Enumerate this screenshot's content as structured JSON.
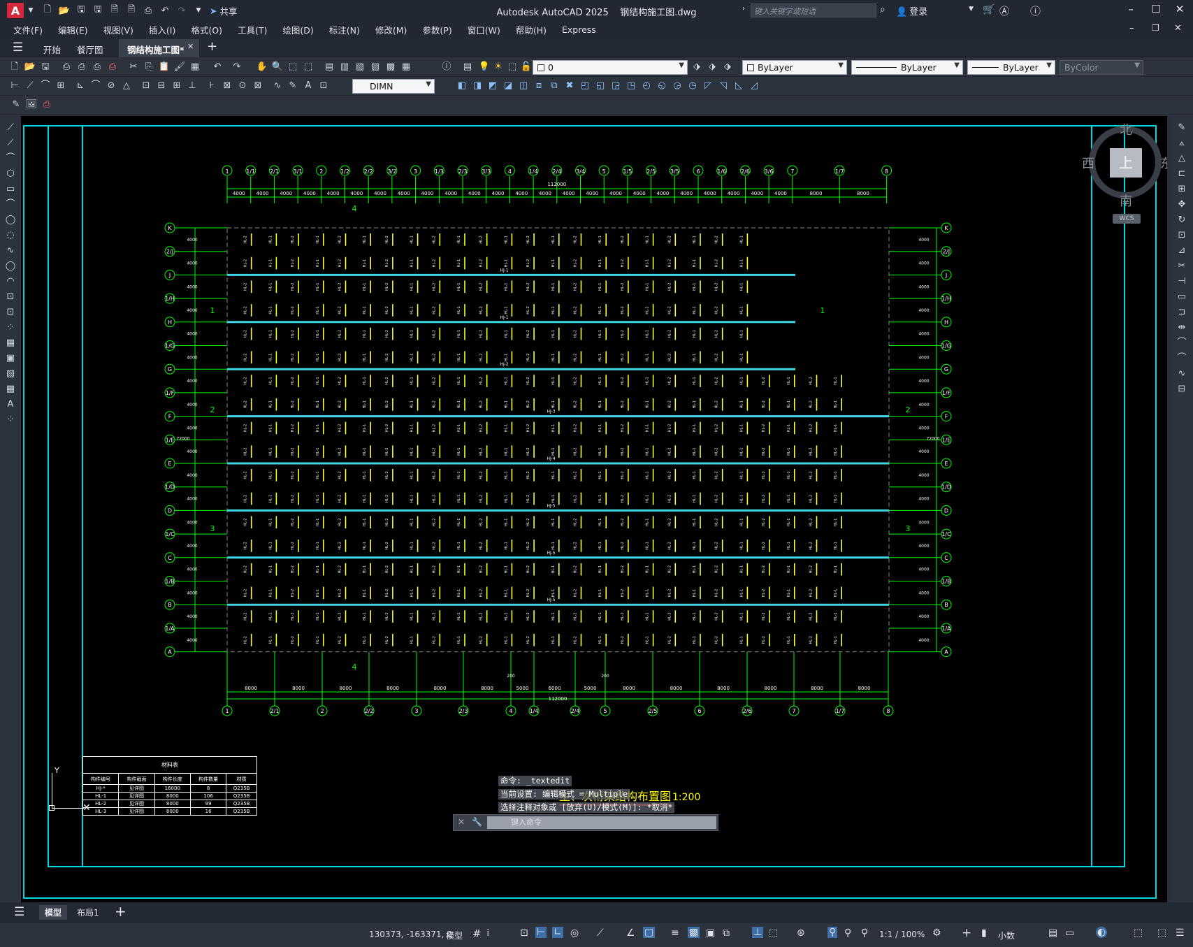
{
  "app": {
    "title": "Autodesk AutoCAD 2025",
    "file": "钢结构施工图.dwg",
    "share": "共享",
    "search_placeholder": "键入关键字或短语",
    "login": "登录",
    "logo": "A"
  },
  "menu": [
    "文件(F)",
    "编辑(E)",
    "视图(V)",
    "插入(I)",
    "格式(O)",
    "工具(T)",
    "绘图(D)",
    "标注(N)",
    "修改(M)",
    "参数(P)",
    "窗口(W)",
    "帮助(H)",
    "Express"
  ],
  "tabs": [
    "开始",
    "餐厅图",
    "钢结构施工图*"
  ],
  "toolbar": {
    "layer_value": "0",
    "color_value": "ByLayer",
    "linetype_value": "ByLayer",
    "lineweight_value": "ByLayer",
    "plotstyle_value": "ByColor",
    "dimstyle_value": "DIMN"
  },
  "viewcube": {
    "n": "北",
    "s": "南",
    "e": "东",
    "w": "西",
    "top": "上",
    "wcs": "WCS"
  },
  "drawing": {
    "title": "主、次桁架结构布置图",
    "scale": "1:200",
    "top_axes": [
      "1",
      "1/1",
      "2/1",
      "3/1",
      "2",
      "1/2",
      "2/2",
      "3/2",
      "3",
      "1/3",
      "2/3",
      "3/3",
      "4",
      "1/4",
      "2/4",
      "3/4",
      "5",
      "1/5",
      "2/5",
      "3/5",
      "6",
      "1/6",
      "2/6",
      "3/6",
      "7",
      "1/7",
      "8"
    ],
    "bottom_axes": [
      "1",
      "2/1",
      "2",
      "2/2",
      "3",
      "2/3",
      "4",
      "1/4",
      "2/4",
      "5",
      "2/5",
      "6",
      "2/6",
      "7",
      "1/7",
      "8"
    ],
    "row_axes": [
      "K",
      "2/J",
      "J",
      "1/H",
      "H",
      "1/G",
      "G",
      "1/F",
      "F",
      "1/E",
      "E",
      "1/D",
      "D",
      "1/C",
      "C",
      "1/B",
      "B",
      "1/A",
      "A"
    ],
    "top_dims": [
      "4000",
      "4000",
      "4000",
      "4000",
      "4000",
      "4000",
      "4000",
      "4000",
      "4000",
      "4000",
      "4000",
      "4000",
      "4000",
      "4000",
      "4000",
      "4000",
      "4000",
      "4000",
      "4000",
      "4000",
      "4000",
      "4000",
      "4000",
      "4000",
      "8000",
      "8000"
    ],
    "bottom_dims": [
      "8000",
      "8000",
      "8000",
      "8000",
      "8000",
      "8000",
      "5000",
      "6000",
      "5000",
      "8000",
      "8000",
      "8000",
      "8000",
      "8000",
      "8000"
    ],
    "total_dim": "112000",
    "side_total": "72000",
    "side_dim": "4000",
    "truss_labels": [
      "HJ-1",
      "HJ-1",
      "HJ-2",
      "HJ-3",
      "HJ-4",
      "HJ-5",
      "HJ-5",
      "HJ-5"
    ],
    "beam_labels": [
      "HL-1",
      "HL-2",
      "HL-3",
      "HJ-3"
    ],
    "section_marks": [
      "1",
      "2",
      "3",
      "4"
    ],
    "marker_200": "200",
    "table": {
      "title": "材料表",
      "headers": [
        "构件编号",
        "构件截面",
        "构件长度",
        "构件数量",
        "材质"
      ],
      "rows": [
        [
          "HJ-*",
          "见详图",
          "16000",
          "8",
          "Q235B"
        ],
        [
          "HL-1",
          "见详图",
          "8000",
          "106",
          "Q235B"
        ],
        [
          "HL-2",
          "见详图",
          "8000",
          "99",
          "Q235B"
        ],
        [
          "HL-3",
          "见详图",
          "8000",
          "16",
          "Q235B"
        ]
      ]
    },
    "ucs_y": "Y"
  },
  "command": {
    "line1": "命令: _textedit",
    "line2": "当前设置: 编辑模式 = Multiple",
    "line3": "选择注释对象或 [放弃(U)/模式(M)]: *取消*",
    "placeholder": "键入命令"
  },
  "layout_tabs": [
    "模型",
    "布局1"
  ],
  "status": {
    "coords": "130373, -163371, 0",
    "model": "模型",
    "scale": "1:1 / 100%",
    "units": "小数"
  }
}
